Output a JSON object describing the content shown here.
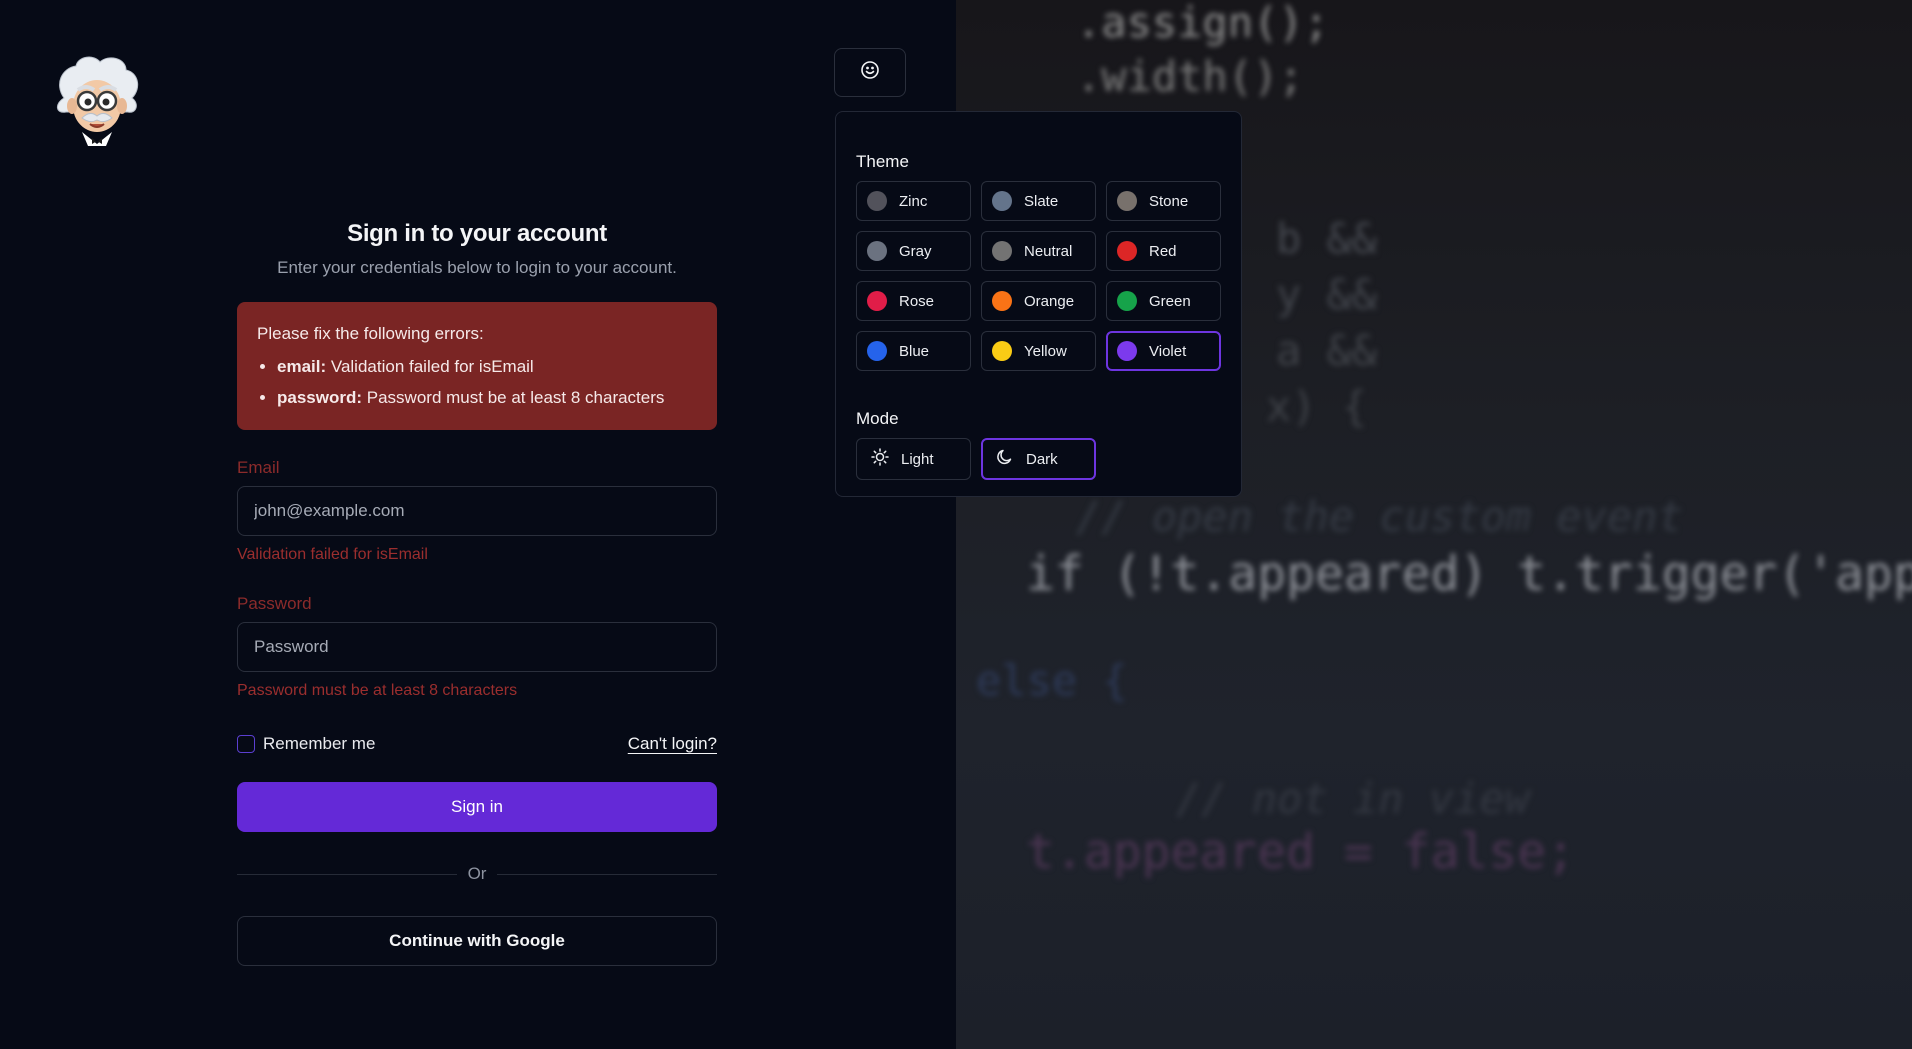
{
  "form": {
    "title": "Sign in to your account",
    "subtitle": "Enter your credentials below to login to your account.",
    "error_summary": {
      "heading": "Please fix the following errors:",
      "items": [
        {
          "field": "email:",
          "message": "Validation failed for isEmail"
        },
        {
          "field": "password:",
          "message": "Password must be at least 8 characters"
        }
      ]
    },
    "email": {
      "label": "Email",
      "placeholder": "john@example.com",
      "error": "Validation failed for isEmail"
    },
    "password": {
      "label": "Password",
      "placeholder": "Password",
      "error": "Password must be at least 8 characters"
    },
    "remember_label": "Remember me",
    "cant_login_link": "Can't login?",
    "submit_label": "Sign in",
    "divider_label": "Or",
    "google_label": "Continue with Google"
  },
  "theme_picker": {
    "toggle_icon": "smiley-icon",
    "theme_heading": "Theme",
    "themes": [
      {
        "label": "Zinc",
        "color": "#52525b"
      },
      {
        "label": "Slate",
        "color": "#64748b"
      },
      {
        "label": "Stone",
        "color": "#78716c"
      },
      {
        "label": "Gray",
        "color": "#6b7280"
      },
      {
        "label": "Neutral",
        "color": "#737373"
      },
      {
        "label": "Red",
        "color": "#dc2626"
      },
      {
        "label": "Rose",
        "color": "#e11d48"
      },
      {
        "label": "Orange",
        "color": "#f97316"
      },
      {
        "label": "Green",
        "color": "#16a34a"
      },
      {
        "label": "Blue",
        "color": "#2563eb"
      },
      {
        "label": "Yellow",
        "color": "#facc15"
      },
      {
        "label": "Violet",
        "color": "#7c3aed"
      }
    ],
    "selected_theme": "Violet",
    "mode_heading": "Mode",
    "modes": [
      {
        "label": "Light",
        "icon": "sun-icon"
      },
      {
        "label": "Dark",
        "icon": "moon-icon"
      }
    ],
    "selected_mode": "Dark"
  },
  "background_code": [
    ".assign();",
    ".width();",
    "b &&",
    "y &&",
    "a &&",
    "x) {",
    "// open the custom event",
    "if (!t.appeared) t.trigger('appear'",
    "else {",
    "// not in view",
    "t.appeared = false;"
  ],
  "colors": {
    "accent": "#6429d7",
    "error_bg": "#7a2524",
    "error_text": "#9b2e2e",
    "background": "#060a16"
  }
}
